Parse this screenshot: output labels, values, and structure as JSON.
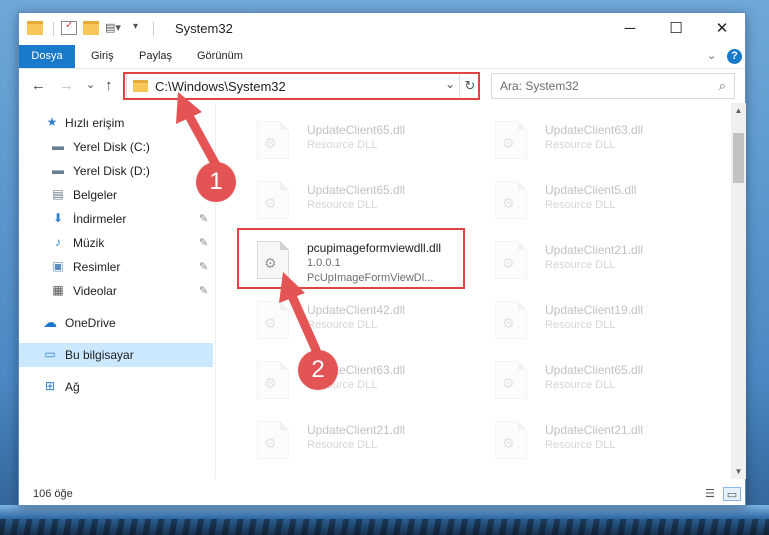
{
  "window": {
    "title": "System32",
    "minimize_glyph": "─",
    "maximize_glyph": "☐",
    "close_glyph": "✕"
  },
  "ribbon": {
    "tabs": [
      "Dosya",
      "Giriş",
      "Paylaş",
      "Görünüm"
    ],
    "help": "?"
  },
  "nav": {
    "back": "←",
    "forward": "→",
    "recent": "⌄",
    "up": "↑",
    "address": "C:\\Windows\\System32",
    "refresh": "↻",
    "chevron": "⌄",
    "search_placeholder": "Ara: System32",
    "search_icon": "⌕"
  },
  "sidebar": {
    "items": [
      {
        "label": "Hızlı erişim",
        "icon": "star-icon",
        "glyph": "★"
      },
      {
        "label": "Yerel Disk (C:)",
        "icon": "drive-icon",
        "glyph": "▬"
      },
      {
        "label": "Yerel Disk (D:)",
        "icon": "drive-icon",
        "glyph": "▬"
      },
      {
        "label": "Belgeler",
        "icon": "documents-icon",
        "glyph": "▤"
      },
      {
        "label": "İndirmeler",
        "icon": "download-icon",
        "glyph": "⬇"
      },
      {
        "label": "Müzik",
        "icon": "music-icon",
        "glyph": "♪"
      },
      {
        "label": "Resimler",
        "icon": "pictures-icon",
        "glyph": "▣"
      },
      {
        "label": "Videolar",
        "icon": "video-icon",
        "glyph": "▦"
      },
      {
        "label": "OneDrive",
        "icon": "cloud-icon",
        "glyph": "☁"
      },
      {
        "label": "Bu bilgisayar",
        "icon": "computer-icon",
        "glyph": "▭"
      },
      {
        "label": "Ağ",
        "icon": "network-icon",
        "glyph": "⊞"
      }
    ],
    "pin_glyph": "✎"
  },
  "files": {
    "left": [
      {
        "name": "UpdateClient65.dll",
        "type": "Resource DLL"
      },
      {
        "name": "UpdateClient65.dll",
        "type": "Resource DLL"
      },
      {
        "name": "pcupimageformviewdll.dll",
        "version": "1.0.0.1",
        "desc": "PcUpImageFormViewDl..."
      },
      {
        "name": "UpdateClient42.dll",
        "type": "Resource DLL"
      },
      {
        "name": "UpdateClient63.dll",
        "type": "Resource DLL"
      },
      {
        "name": "UpdateClient21.dll",
        "type": "Resource DLL"
      }
    ],
    "right": [
      {
        "name": "UpdateClient63.dll",
        "type": "Resource DLL"
      },
      {
        "name": "UpdateClient5.dll",
        "type": "Resource DLL"
      },
      {
        "name": "UpdateClient21.dll",
        "type": "Resource DLL"
      },
      {
        "name": "UpdateClient19.dll",
        "type": "Resource DLL"
      },
      {
        "name": "UpdateClient65.dll",
        "type": "Resource DLL"
      },
      {
        "name": "UpdateClient21.dll",
        "type": "Resource DLL"
      }
    ]
  },
  "status": {
    "count": "106 öğe"
  },
  "annotations": {
    "step1": "1",
    "step2": "2",
    "color": "#e04444"
  }
}
